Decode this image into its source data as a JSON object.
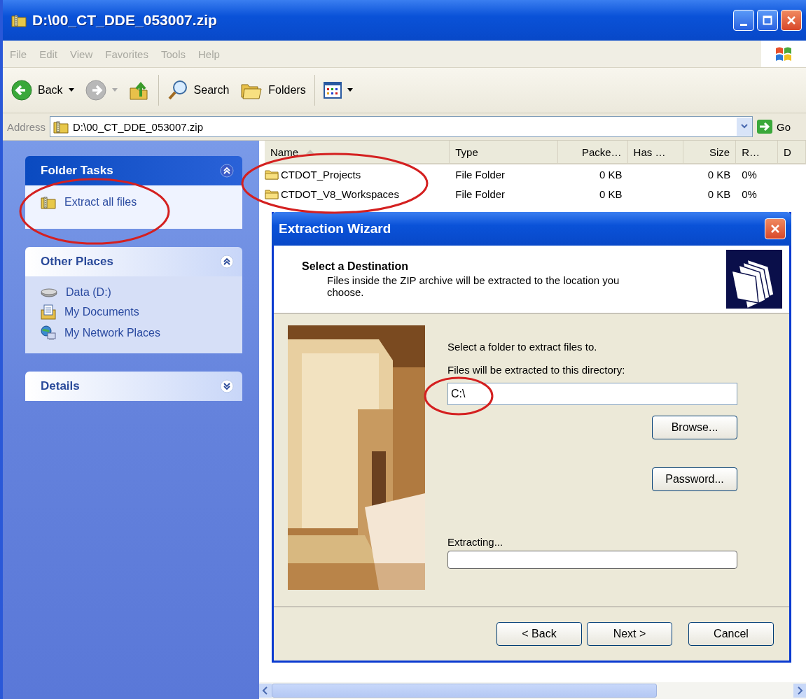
{
  "window": {
    "title": "D:\\00_CT_DDE_053007.zip"
  },
  "menu": [
    "File",
    "Edit",
    "View",
    "Favorites",
    "Tools",
    "Help"
  ],
  "toolbar": [
    {
      "kind": "back",
      "label": "Back"
    },
    {
      "kind": "forward"
    },
    {
      "kind": "up"
    },
    {
      "kind": "search",
      "label": "Search"
    },
    {
      "kind": "folders",
      "label": "Folders"
    },
    {
      "kind": "views"
    }
  ],
  "address": {
    "label": "Address",
    "value": "D:\\00_CT_DDE_053007.zip",
    "go": "Go"
  },
  "sidebar": {
    "panels": [
      {
        "title": "Folder Tasks",
        "kind": "special",
        "expanded": true,
        "items": [
          {
            "kind": "zip",
            "label": "Extract all files"
          }
        ]
      },
      {
        "title": "Other Places",
        "kind": "normal",
        "expanded": true,
        "items": [
          {
            "kind": "drive",
            "label": "Data (D:)"
          },
          {
            "kind": "documents",
            "label": "My Documents"
          },
          {
            "kind": "network",
            "label": "My Network Places"
          }
        ]
      },
      {
        "title": "Details",
        "kind": "normal",
        "expanded": false
      }
    ]
  },
  "file_list": {
    "columns": [
      {
        "label": "Name",
        "sorted": true
      },
      {
        "label": "Type",
        "sorted": false
      },
      {
        "label": "Packe…",
        "sorted": false
      },
      {
        "label": "Has …",
        "sorted": false
      },
      {
        "label": "Size",
        "sorted": false
      },
      {
        "label": "R…",
        "sorted": false
      },
      {
        "label": "D",
        "sorted": false
      }
    ],
    "rows": [
      {
        "cells": [
          "CTDOT_Projects",
          "File Folder",
          "0 KB",
          null,
          "0 KB",
          "0%",
          null
        ]
      },
      {
        "cells": [
          "CTDOT_V8_Workspaces",
          "File Folder",
          "0 KB",
          null,
          "0 KB",
          "0%",
          null
        ]
      }
    ]
  },
  "dialog": {
    "title": "Extraction Wizard",
    "heading": "Select a Destination",
    "description": "Files inside the ZIP archive will be extracted to the location you choose.",
    "prompt": "Select a folder to extract files to.",
    "field_label": "Files will be extracted to this directory:",
    "path": "C:\\",
    "side_buttons": [
      "Browse...",
      "Password..."
    ],
    "progress": {
      "label": "Extracting...",
      "level": 0
    },
    "buttons": [
      "< Back",
      "Next >",
      "Cancel"
    ]
  }
}
